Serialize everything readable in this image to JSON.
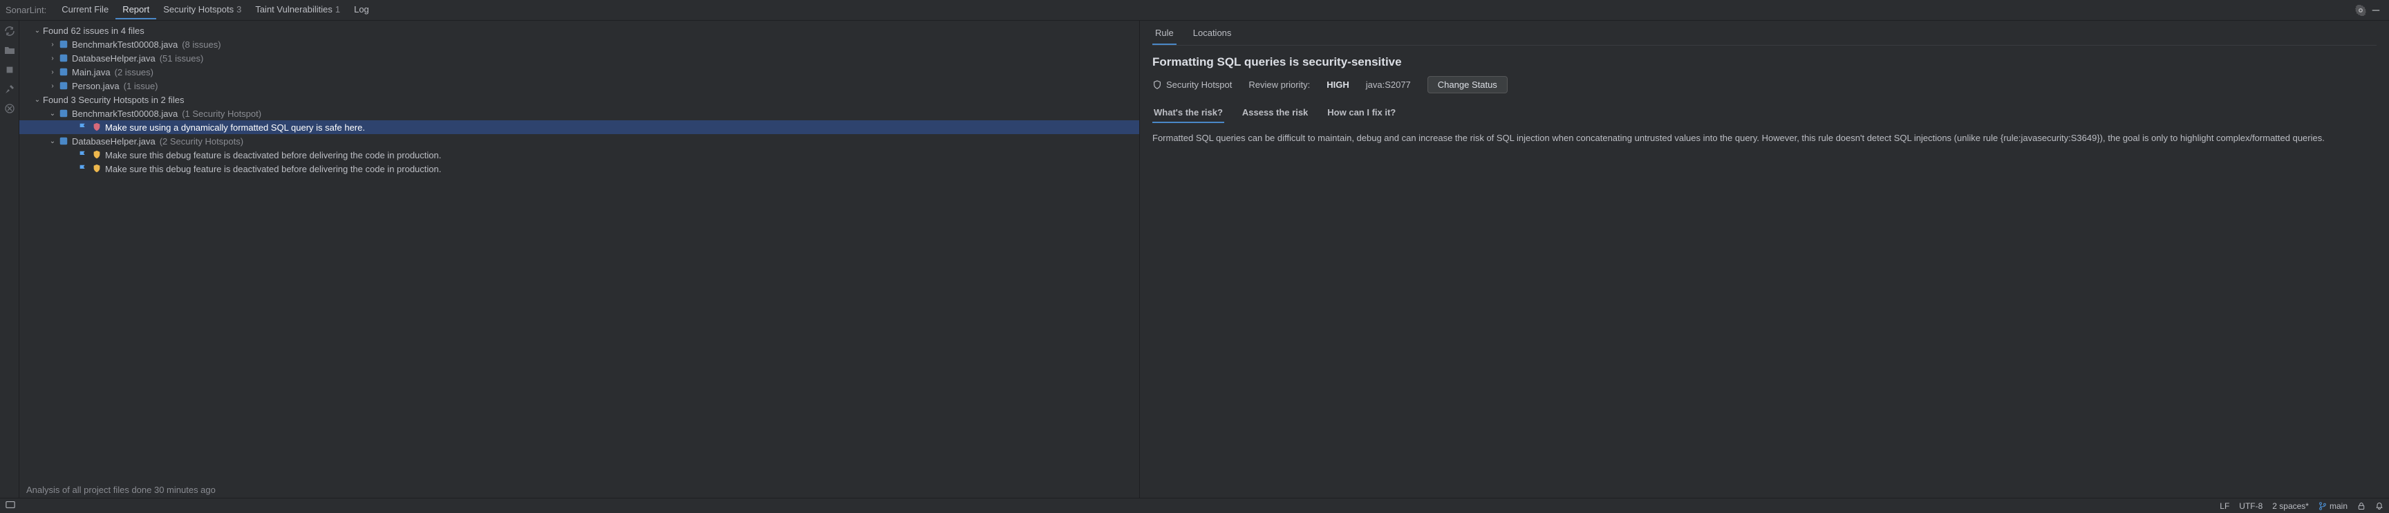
{
  "toolbar": {
    "label": "SonarLint:",
    "tabs": [
      {
        "label": "Current File"
      },
      {
        "label": "Report"
      },
      {
        "label": "Security Hotspots",
        "badge": "3"
      },
      {
        "label": "Taint Vulnerabilities",
        "badge": "1"
      },
      {
        "label": "Log"
      }
    ]
  },
  "tree": {
    "issues_summary": "Found 62 issues in 4 files",
    "issue_files": [
      {
        "name": "BenchmarkTest00008.java",
        "count": "(8 issues)"
      },
      {
        "name": "DatabaseHelper.java",
        "count": "(51 issues)"
      },
      {
        "name": "Main.java",
        "count": "(2 issues)"
      },
      {
        "name": "Person.java",
        "count": "(1 issue)"
      }
    ],
    "hotspots_summary": "Found 3 Security Hotspots in 2 files",
    "hotspot_files": [
      {
        "name": "BenchmarkTest00008.java",
        "count": "(1 Security Hotspot)",
        "items": [
          {
            "label": "Make sure using a dynamically formatted SQL query is safe here.",
            "selected": true
          }
        ]
      },
      {
        "name": "DatabaseHelper.java",
        "count": "(2 Security Hotspots)",
        "items": [
          {
            "label": "Make sure this debug feature is deactivated before delivering the code in production."
          },
          {
            "label": "Make sure this debug feature is deactivated before delivering the code in production."
          }
        ]
      }
    ],
    "status": "Analysis of all project files done 30 minutes ago"
  },
  "detail": {
    "tabs": {
      "rule": "Rule",
      "locations": "Locations"
    },
    "title": "Formatting SQL queries is security-sensitive",
    "type_label": "Security Hotspot",
    "priority_label": "Review priority:",
    "priority_value": "HIGH",
    "rule_key": "java:S2077",
    "change_status": "Change Status",
    "subtabs": {
      "risk": "What's the risk?",
      "assess": "Assess the risk",
      "fix": "How can I fix it?"
    },
    "description": "Formatted SQL queries can be difficult to maintain, debug and can increase the risk of SQL injection when concatenating untrusted values into the query. However, this rule doesn't detect SQL injections (unlike rule {rule:javasecurity:S3649}), the goal is only to highlight complex/formatted queries."
  },
  "bottombar": {
    "line_ending": "LF",
    "encoding": "UTF-8",
    "indent": "2 spaces*",
    "branch": "main"
  }
}
